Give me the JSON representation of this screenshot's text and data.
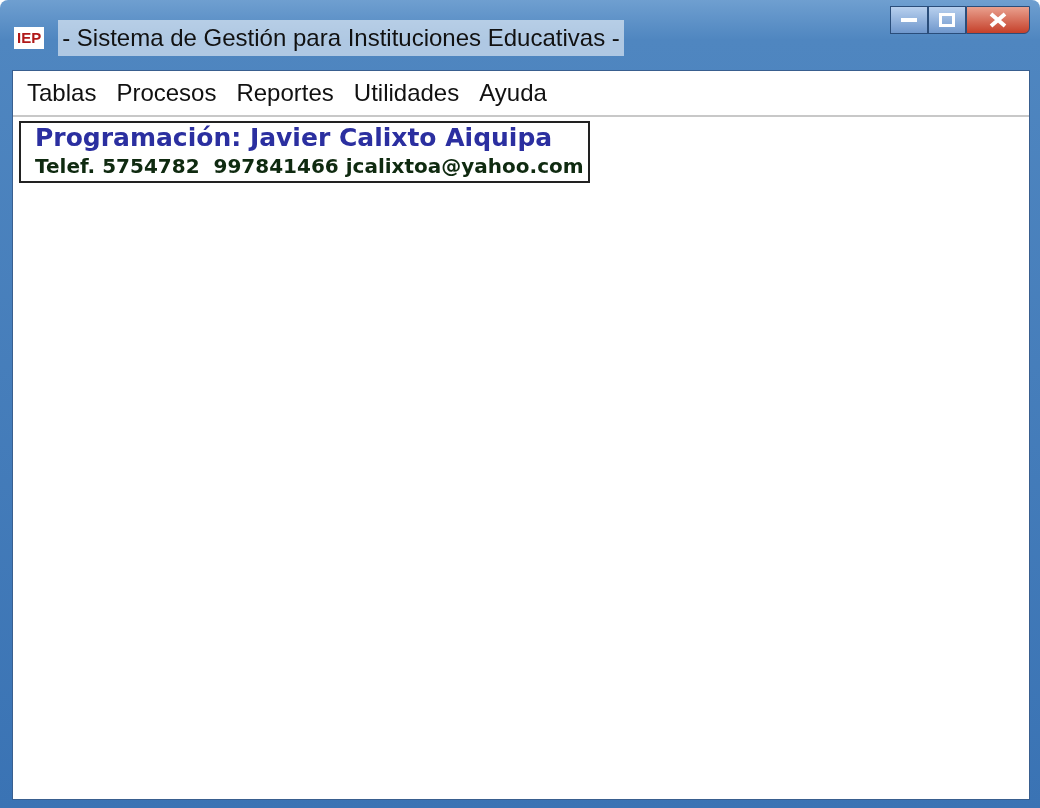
{
  "window": {
    "icon_text": "IEP",
    "title": "- Sistema de Gestión para Instituciones Educativas -"
  },
  "menu": [
    "Tablas",
    "Procesos",
    "Reportes",
    "Utilidades",
    "Ayuda"
  ],
  "credits": {
    "author": "Programación: Javier Calixto Aiquipa",
    "contact": "Telef. 5754782  997841466 jcalixtoa@yahoo.com"
  }
}
